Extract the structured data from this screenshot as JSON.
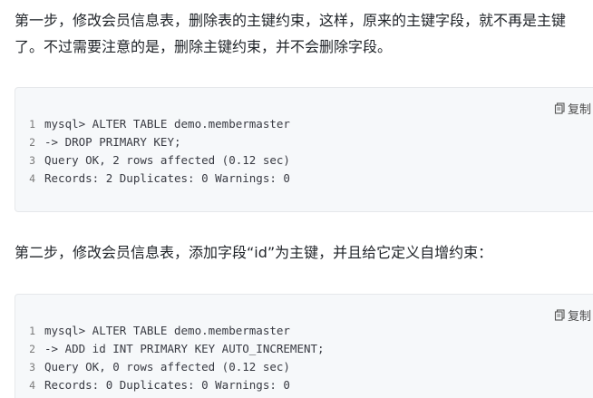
{
  "paragraphs": {
    "p1_line1": "第一步，修改会员信息表，删除表的主键约束，这样，原来的主键字段，就不再是主键",
    "p1_line2": "了。不过需要注意的是，删除主键约束，并不会删除字段。",
    "p2": "第二步，修改会员信息表，添加字段“id”为主键，并且给它定义自增约束："
  },
  "copy_label": "复制",
  "code_blocks": [
    {
      "lines": [
        {
          "num": "1",
          "text": "mysql> ALTER TABLE demo.membermaster"
        },
        {
          "num": "2",
          "text": "-> DROP PRIMARY KEY;"
        },
        {
          "num": "3",
          "text": "Query OK, 2 rows affected (0.12 sec)"
        },
        {
          "num": "4",
          "text": "Records: 2 Duplicates: 0 Warnings: 0"
        }
      ]
    },
    {
      "lines": [
        {
          "num": "1",
          "text": "mysql> ALTER TABLE demo.membermaster"
        },
        {
          "num": "2",
          "text": "-> ADD id INT PRIMARY KEY AUTO_INCREMENT;"
        },
        {
          "num": "3",
          "text": "Query OK, 0 rows affected (0.12 sec)"
        },
        {
          "num": "4",
          "text": "Records: 0 Duplicates: 0 Warnings: 0"
        }
      ]
    }
  ]
}
